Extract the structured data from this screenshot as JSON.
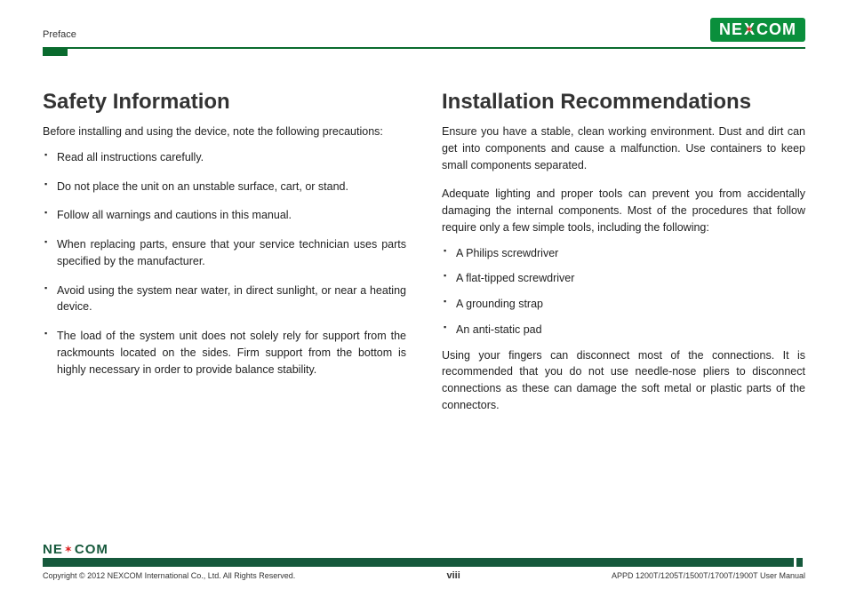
{
  "header": {
    "section": "Preface",
    "brand_left": "NE",
    "brand_x": "X",
    "brand_right": "COM"
  },
  "left": {
    "title": "Safety Information",
    "intro": "Before installing and using the device, note the following precautions:",
    "items": [
      "Read all instructions carefully.",
      "Do not place the unit on an unstable surface, cart, or stand.",
      "Follow all warnings and cautions in this manual.",
      "When replacing parts, ensure that your service technician uses parts specified by the manufacturer.",
      "Avoid using the system near water, in direct sunlight, or near a heating device.",
      "The load of the system unit does not solely rely for support from the rackmounts located on the sides. Firm support from the bottom is highly necessary in order to provide balance stability."
    ]
  },
  "right": {
    "title": "Installation Recommendations",
    "p1": "Ensure you have a stable, clean working environment. Dust and dirt can get into components and cause a malfunction. Use containers to keep small components separated.",
    "p2": "Adequate lighting and proper tools can prevent you from accidentally damaging the internal components. Most of the procedures that follow require only a few simple tools, including the following:",
    "items": [
      "A Philips screwdriver",
      "A flat-tipped screwdriver",
      "A grounding strap",
      "An anti-static pad"
    ],
    "p3": "Using your fingers can disconnect most of the connections. It is recommended that you do not use needle-nose pliers to disconnect connections as these can damage the soft metal or plastic parts of the connectors."
  },
  "footer": {
    "copyright": "Copyright © 2012 NEXCOM International Co., Ltd. All Rights Reserved.",
    "page": "viii",
    "doc": "APPD 1200T/1205T/1500T/1700T/1900T User Manual"
  }
}
